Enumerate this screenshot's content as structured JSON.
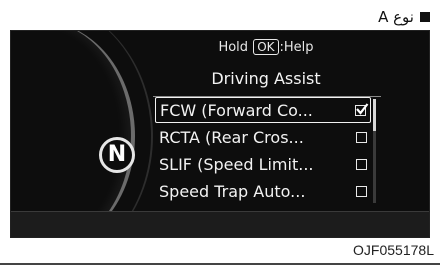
{
  "figure": {
    "type_label": "نوع A",
    "code": "OJF055178L"
  },
  "cluster": {
    "gear": "N"
  },
  "screen": {
    "hint_prefix": "Hold",
    "hint_key": "OK",
    "hint_suffix": ":Help",
    "title": "Driving Assist",
    "items": [
      {
        "label": "FCW (Forward Co...",
        "checked": true,
        "selected": true
      },
      {
        "label": "RCTA (Rear Cros...",
        "checked": false,
        "selected": false
      },
      {
        "label": "SLIF (Speed Limit...",
        "checked": false,
        "selected": false
      },
      {
        "label": "Speed Trap Auto...",
        "checked": false,
        "selected": false
      }
    ],
    "scroll_position": 0.0
  }
}
